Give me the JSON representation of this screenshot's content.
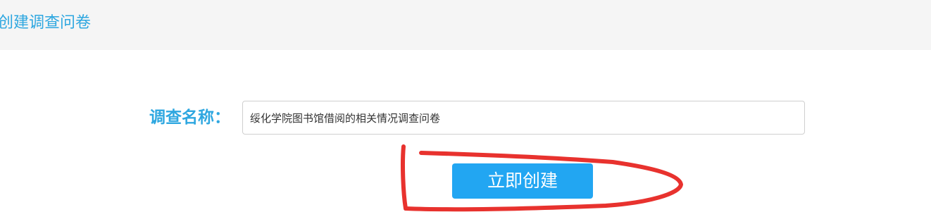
{
  "header": {
    "title": "创建调查问卷"
  },
  "form": {
    "name_label": "调查名称：",
    "name_value": "绥化学院图书馆借阅的相关情况调查问卷"
  },
  "actions": {
    "create_label": "立即创建"
  },
  "colors": {
    "accent": "#2ea7e0",
    "button": "#22a6f2",
    "annotation": "#e8322e"
  }
}
